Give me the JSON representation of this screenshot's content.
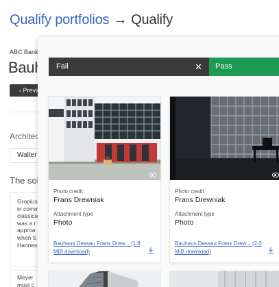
{
  "header": {
    "crumb_link": "Qualify portfolios",
    "arrow": "→",
    "current": "Qualify"
  },
  "background": {
    "org": "ABC Bank",
    "name": "Bauhaus",
    "prev_label": "‹ Previous",
    "section_architect": "Architect",
    "architect_value": "Walter",
    "section_solution": "The solution",
    "solution_lines": [
      "Gropius",
      "in comm",
      "classica",
      "was a r",
      "approa",
      "when S",
      "Hannes"
    ],
    "extra_lines": [
      "Meyer",
      "most c"
    ]
  },
  "filter": {
    "fail_label": "Fail",
    "clear_icon": "close-icon",
    "pass_label": "Pass"
  },
  "cards": [
    {
      "credit_label": "Photo credit",
      "credit_value": "Frans Drewniak",
      "type_label": "Attachment type",
      "type_value": "Photo",
      "download_text": "Bauhaus Dessau Frans Drew... (1.8 MiB download)"
    },
    {
      "credit_label": "Photo credit",
      "credit_value": "Frans Drewniak",
      "type_label": "Attachment type",
      "type_value": "Photo",
      "download_text": "Bauhaus Dessau Frans Drew... (2.0 MiB download)"
    }
  ],
  "colors": {
    "link": "#3a63c8",
    "fail_bg": "#3b3b3b",
    "pass_bg": "#1e9a52"
  }
}
